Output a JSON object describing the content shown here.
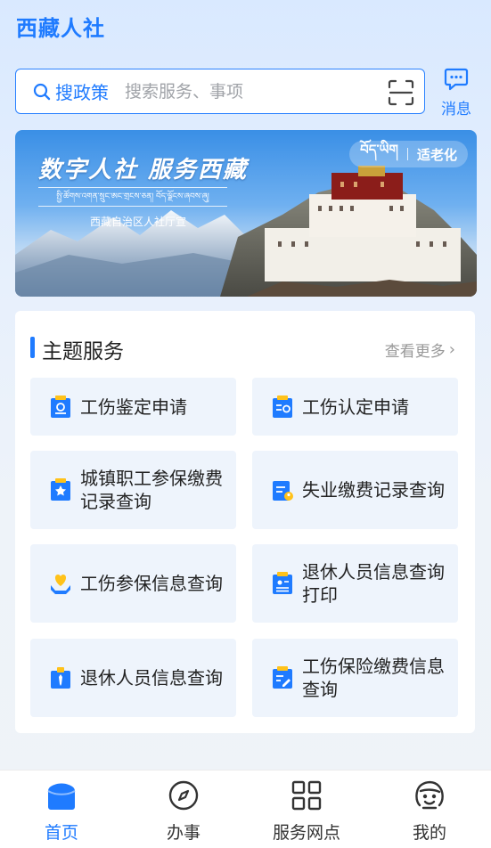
{
  "app": {
    "title": "西藏人社"
  },
  "search": {
    "label": "搜政策",
    "placeholder": "搜索服务、事项",
    "scan_icon": "scan-icon"
  },
  "header": {
    "message_label": "消息",
    "message_icon": "message-icon"
  },
  "banner": {
    "slogan": "数字人社 服务西藏",
    "tibetan_text": "སྤྱི་ཚོགས་འགན་སྲུང་ཨང་གྲངས་ཅན། བོད་ལྗོངས་ཞབས་ཞུ།",
    "org": "西藏自治区人社厅宣",
    "elder_tibetan": "བོད་ཡིག",
    "elder_label": "适老化"
  },
  "themes": {
    "title": "主题服务",
    "more_label": "查看更多",
    "items": [
      {
        "label": "工伤鉴定申请",
        "icon": "document-icon"
      },
      {
        "label": "工伤认定申请",
        "icon": "id-card-icon"
      },
      {
        "label": "城镇职工参保缴费记录查询",
        "icon": "star-document-icon"
      },
      {
        "label": "失业缴费记录查询",
        "icon": "document-person-icon"
      },
      {
        "label": "工伤参保信息查询",
        "icon": "heart-hands-icon"
      },
      {
        "label": "退休人员信息查询打印",
        "icon": "profile-document-icon"
      },
      {
        "label": "退休人员信息查询",
        "icon": "tie-badge-icon"
      },
      {
        "label": "工伤保险缴费信息查询",
        "icon": "edit-document-icon"
      }
    ]
  },
  "tabbar": {
    "items": [
      {
        "label": "首页",
        "icon": "home-icon",
        "active": true
      },
      {
        "label": "办事",
        "icon": "compass-icon",
        "active": false
      },
      {
        "label": "服务网点",
        "icon": "grid-icon",
        "active": false
      },
      {
        "label": "我的",
        "icon": "user-face-icon",
        "active": false
      }
    ]
  },
  "colors": {
    "accent": "#1f7bff",
    "icon_yellow": "#ffc21a",
    "tile_bg": "#eef4fc"
  }
}
